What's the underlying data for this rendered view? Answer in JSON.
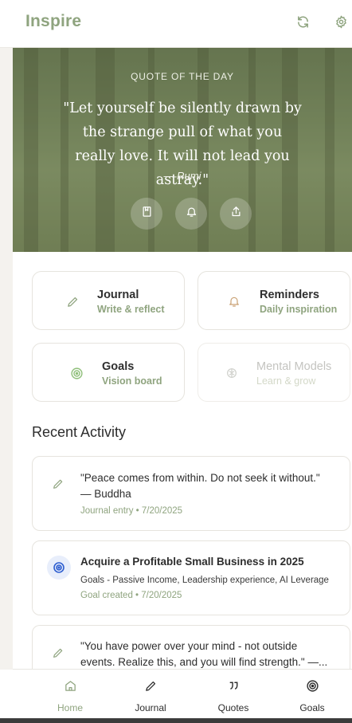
{
  "header": {
    "title": "Inspire",
    "refresh_icon": "refresh-icon",
    "settings_icon": "gear-icon"
  },
  "hero": {
    "kicker": "QUOTE OF THE DAY",
    "quote": "\"Let yourself be silently drawn by the strange pull of what you really love. It will not lead you astray.\"",
    "author": "— Rumi",
    "actions": [
      "bookmark-icon",
      "bell-icon",
      "share-icon"
    ]
  },
  "cards": [
    {
      "title": "Journal",
      "subtitle": "Write & reflect",
      "icon": "pencil-icon"
    },
    {
      "title": "Reminders",
      "subtitle": "Daily inspiration",
      "icon": "bell-icon"
    },
    {
      "title": "Goals",
      "subtitle": "Vision board",
      "icon": "target-icon"
    },
    {
      "title": "Mental Models",
      "subtitle": "Learn & grow",
      "icon": "brain-icon"
    }
  ],
  "recent": {
    "title": "Recent Activity",
    "items": [
      {
        "text": "\"Peace comes from within. Do not seek it without.\" — Buddha",
        "meta": "Journal entry • 7/20/2025",
        "icon": "pencil-icon"
      },
      {
        "text": "Acquire a Profitable Small Business in 2025",
        "desc": "Goals - Passive Income, Leadership experience, AI Leverage",
        "meta": "Goal created • 7/20/2025",
        "icon": "target-icon"
      },
      {
        "text": "\"You have power over your mind - not outside events. Realize this, and you will find strength.\" —...",
        "icon": "pencil-icon"
      }
    ]
  },
  "nav": {
    "items": [
      {
        "label": "Home",
        "icon": "home-icon"
      },
      {
        "label": "Journal",
        "icon": "pencil-icon"
      },
      {
        "label": "Quotes",
        "icon": "quote-icon"
      },
      {
        "label": "Goals",
        "icon": "target-icon"
      }
    ]
  },
  "colors": {
    "accent": "#8fa47f",
    "hero_base": "#6f7e57",
    "goal_icon": "#2f5fd0"
  }
}
